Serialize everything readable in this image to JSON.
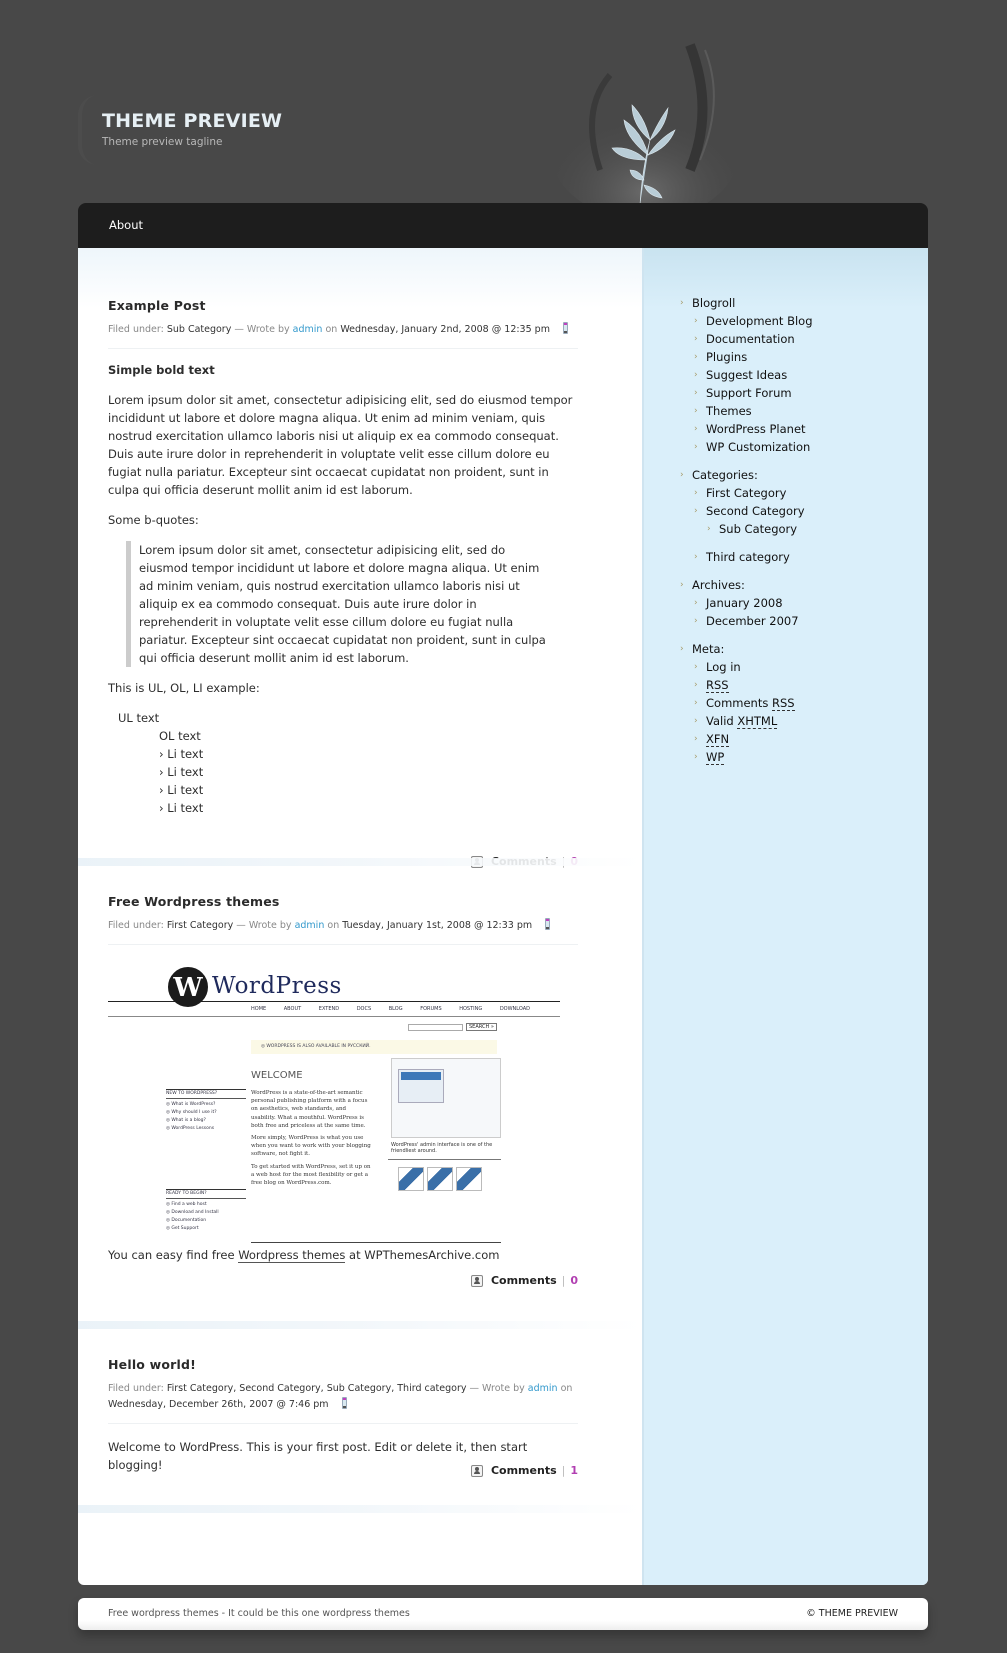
{
  "header": {
    "title": "THEME PREVIEW",
    "tagline": "Theme preview tagline"
  },
  "nav": {
    "items": [
      {
        "label": "About"
      }
    ]
  },
  "posts": [
    {
      "title": "Example Post",
      "meta": {
        "filed_label": "Filed under:",
        "categories": "Sub Category",
        "wrote_label": "— Wrote by",
        "author": "admin",
        "on_label": "on",
        "date": "Wednesday, January 2nd, 2008 @ 12:35 pm"
      },
      "bold_text": "Simple bold text",
      "paragraph": "Lorem ipsum dolor sit amet, consectetur adipisicing elit, sed do eiusmod tempor incididunt ut labore et dolore magna aliqua. Ut enim ad minim veniam, quis nostrud exercitation ullamco laboris nisi ut aliquip ex ea commodo consequat. Duis aute irure dolor in reprehenderit in voluptate velit esse cillum dolore eu fugiat nulla pariatur. Excepteur sint occaecat cupidatat non proident, sunt in culpa qui officia deserunt mollit anim id est laborum.",
      "bquote_intro": "Some b-quotes:",
      "blockquote": "Lorem ipsum dolor sit amet, consectetur adipisicing elit, sed do eiusmod tempor incididunt ut labore et dolore magna aliqua. Ut enim ad minim veniam, quis nostrud exercitation ullamco laboris nisi ut aliquip ex ea commodo consequat. Duis aute irure dolor in reprehenderit in voluptate velit esse cillum dolore eu fugiat nulla pariatur. Excepteur sint occaecat cupidatat non proident, sunt in culpa qui officia deserunt mollit anim id est laborum.",
      "list_intro": "This is UL, OL, LI example:",
      "ul_text": "UL text",
      "ol_text": "OL text",
      "li_items": [
        "› Li text",
        "› Li text",
        "› Li text",
        "› Li text"
      ],
      "comments_label": "Comments",
      "comments_count": "0"
    },
    {
      "title": "Free Wordpress themes",
      "meta": {
        "filed_label": "Filed under:",
        "categories": "First Category",
        "wrote_label": "— Wrote by",
        "author": "admin",
        "on_label": "on",
        "date": "Tuesday, January 1st, 2008 @ 12:33 pm"
      },
      "image": {
        "logo_letter": "W",
        "logo_word": "WordPress",
        "nav": [
          "HOME",
          "ABOUT",
          "EXTEND",
          "DOCS",
          "BLOG",
          "FORUMS",
          "HOSTING",
          "DOWNLOAD"
        ],
        "search_button": "SEARCH »",
        "notice": "◎ WORDPRESS IS ALSO AVAILABLE IN РУССКИЙ.",
        "welcome": "WELCOME",
        "para1": "WordPress is a state-of-the-art semantic personal publishing platform with a focus on aesthetics, web standards, and usability. What a mouthful. WordPress is both free and priceless at the same time.",
        "para2": "More simply, WordPress is what you use when you want to work with your blogging software, not fight it.",
        "para3": "To get started with WordPress, set it up on a web host for the most flexibility or get a free blog on WordPress.com.",
        "side1_heading": "NEW TO WORDPRESS?",
        "side1_items": [
          "◎ What is WordPress?",
          "◎ Why should I use it?",
          "◎ What is a blog?",
          "◎ WordPress Lessons"
        ],
        "side2_heading": "READY TO BEGIN?",
        "side2_items": [
          "◎ Find a web host",
          "◎ Download and Install",
          "◎ Documentation",
          "◎ Get Support"
        ],
        "admin_caption": "WordPress' admin interface is one of the friendliest around."
      },
      "text_before": "You can easy find free",
      "link_text": "Wordpress themes",
      "text_after": "at WPThemesArchive.com",
      "comments_label": "Comments",
      "comments_count": "0"
    },
    {
      "title": "Hello world!",
      "meta": {
        "filed_label": "Filed under:",
        "categories": "First Category, Second Category, Sub Category, Third category",
        "wrote_label": "— Wrote by",
        "author": "admin",
        "on_label": "on",
        "date": "Wednesday, December 26th, 2007 @ 7:46 pm"
      },
      "paragraph": "Welcome to WordPress. This is your first post. Edit or delete it, then start blogging!",
      "comments_label": "Comments",
      "comments_count": "1"
    }
  ],
  "sidebar": {
    "blogroll": {
      "heading": "Blogroll",
      "items": [
        "Development Blog",
        "Documentation",
        "Plugins",
        "Suggest Ideas",
        "Support Forum",
        "Themes",
        "WordPress Planet",
        "WP Customization"
      ]
    },
    "categories": {
      "heading": "Categories:",
      "items": [
        "First Category",
        "Second Category",
        "Sub Category",
        "Third category"
      ]
    },
    "archives": {
      "heading": "Archives:",
      "items": [
        "January 2008",
        "December 2007"
      ]
    },
    "meta": {
      "heading": "Meta:",
      "login": "Log in",
      "rss": "RSS",
      "comments_prefix": "Comments",
      "comments_rss": "RSS",
      "valid_prefix": "Valid",
      "xhtml": "XHTML",
      "xfn": "XFN",
      "wp": "WP"
    },
    "arrow_glyph": "›"
  },
  "footer": {
    "left": "Free wordpress themes - It could be this one wordpress themes",
    "right": "© THEME PREVIEW"
  },
  "colors": {
    "background": "#484848",
    "nav": "#1d1d1d",
    "sidebar": "#daeffa",
    "author_link": "#3399cc",
    "comment_count": "#b13fb1"
  }
}
